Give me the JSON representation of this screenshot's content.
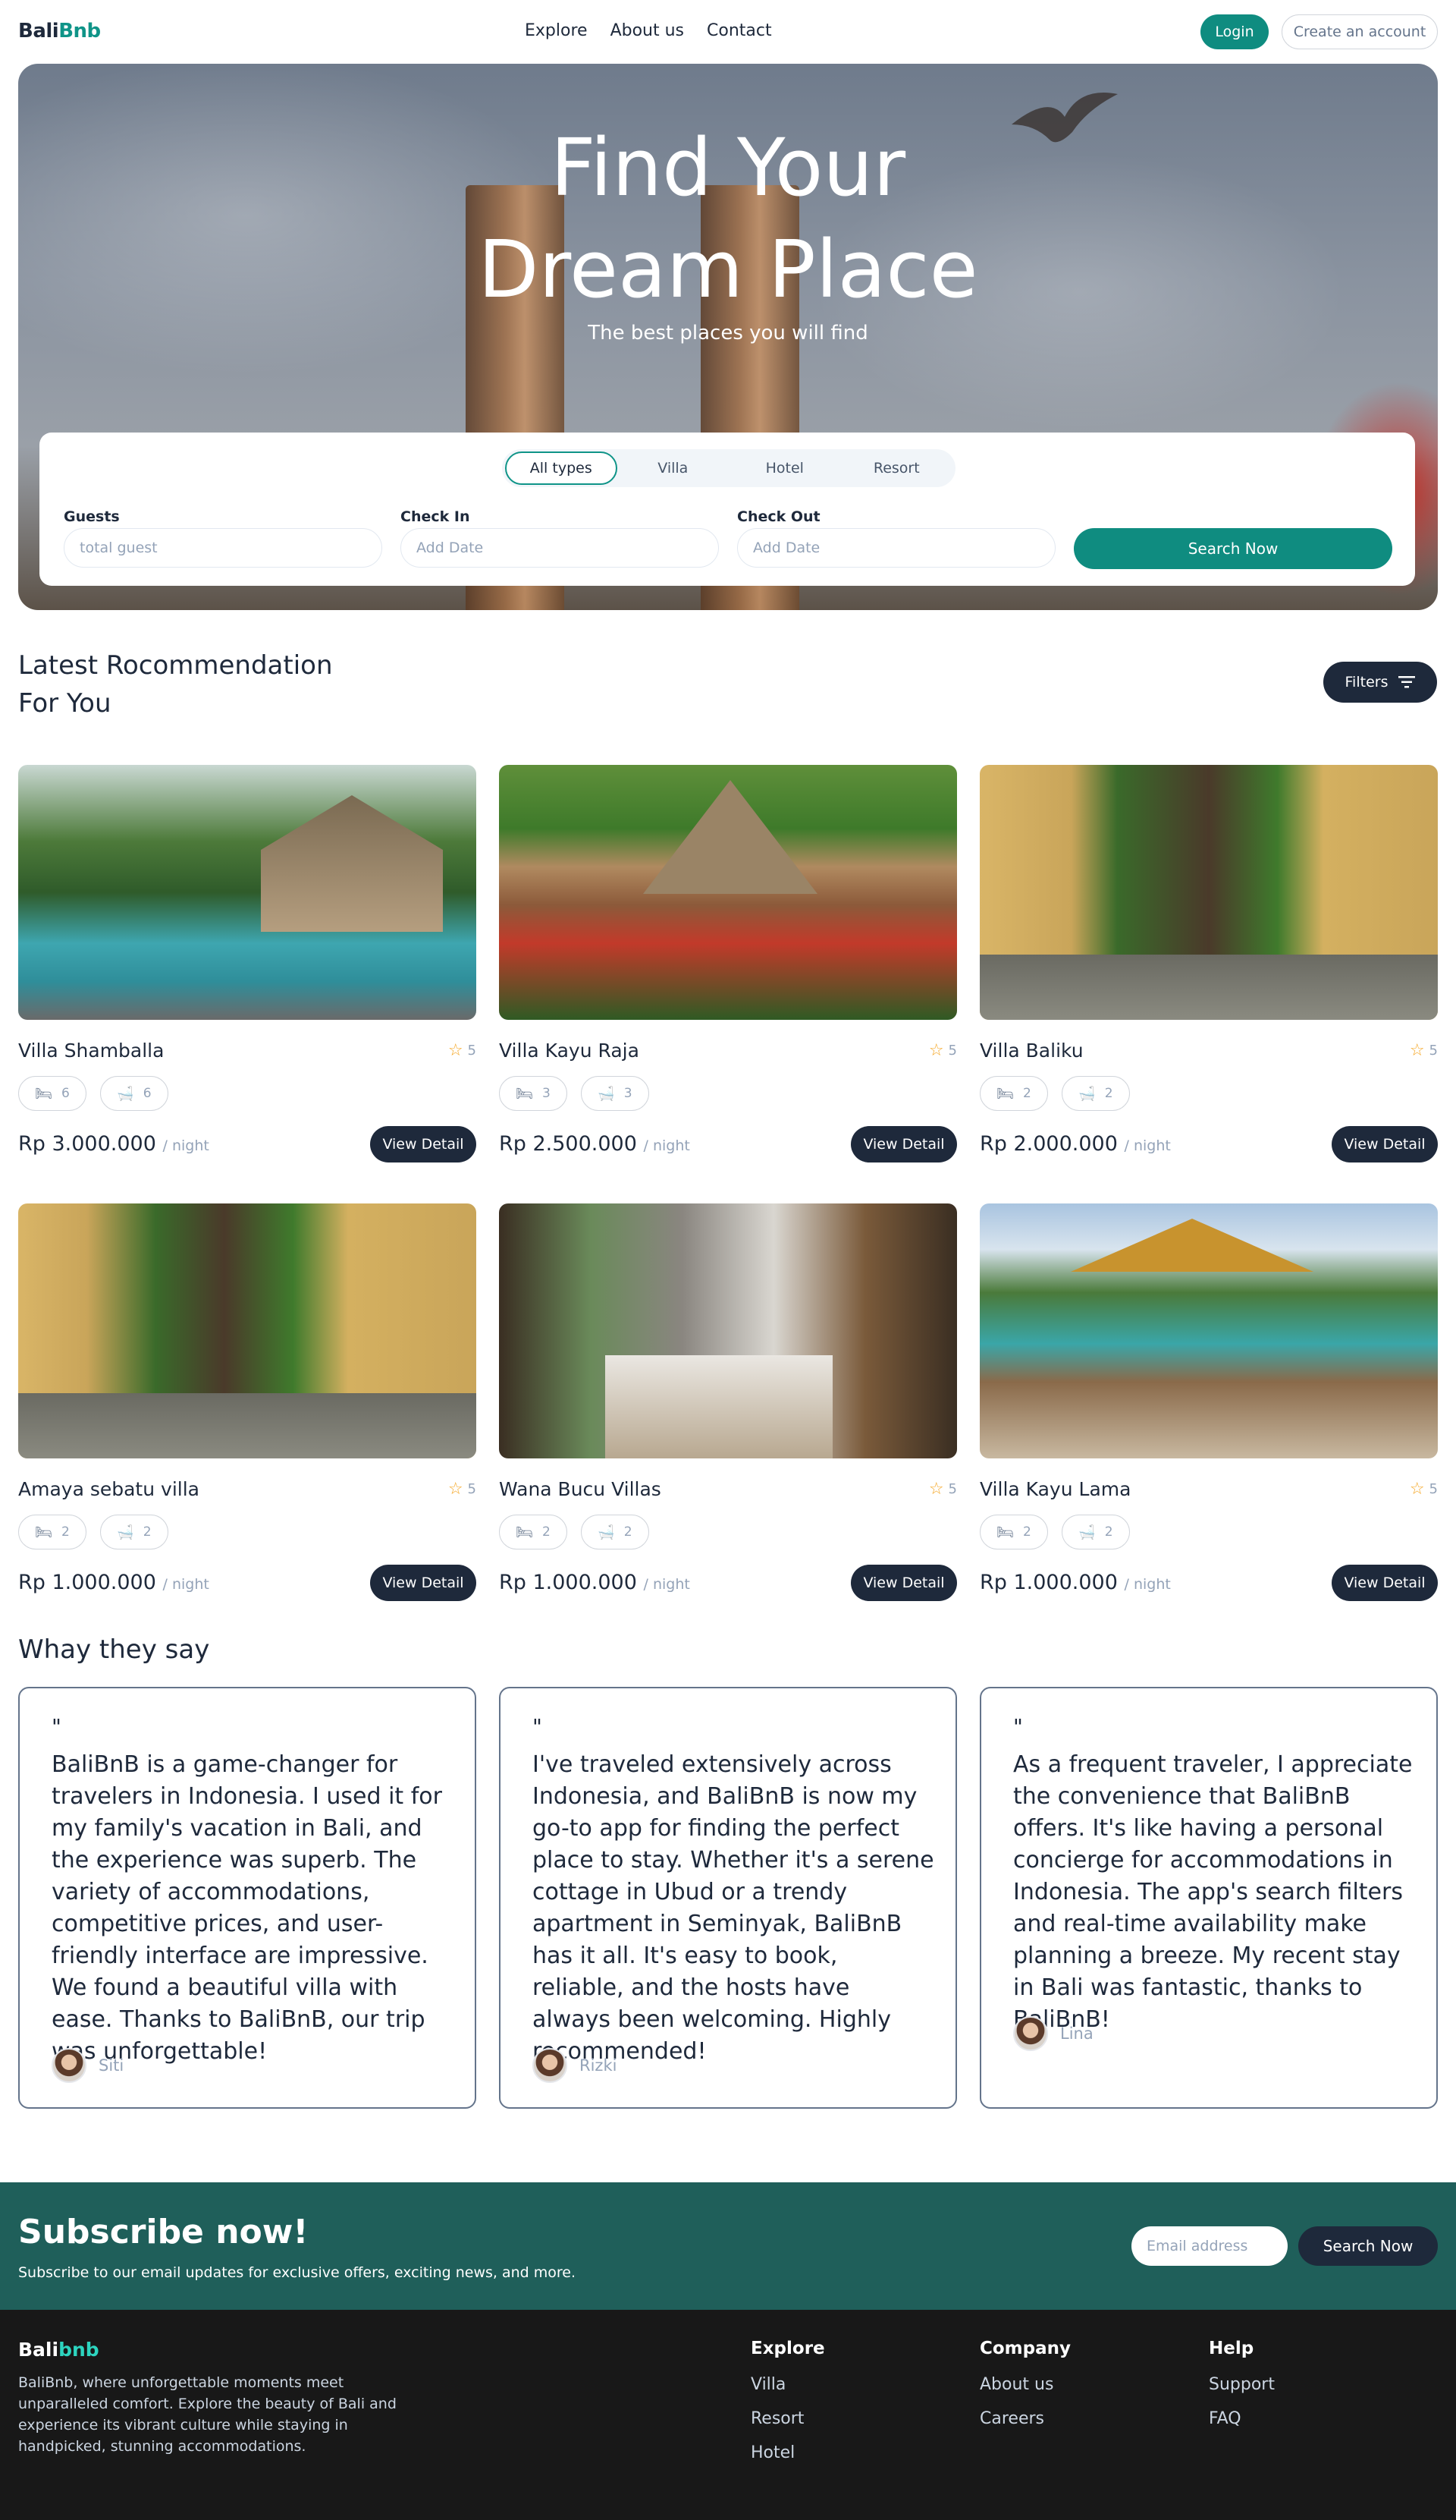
{
  "nav": {
    "logo_a": "Bali",
    "logo_b": "Bnb",
    "links": [
      "Explore",
      "About us",
      "Contact"
    ],
    "login": "Login",
    "create_account": "Create an account"
  },
  "hero": {
    "title_line1": "Find Your",
    "title_line2": "Dream Place",
    "subtitle": "The best places you will find"
  },
  "search": {
    "types": [
      "All types",
      "Villa",
      "Hotel",
      "Resort"
    ],
    "active_type": "All types",
    "guests_label": "Guests",
    "guests_placeholder": "total guest",
    "checkin_label": "Check In",
    "checkin_placeholder": "Add Date",
    "checkout_label": "Check Out",
    "checkout_placeholder": "Add Date",
    "button": "Search Now"
  },
  "recommendations": {
    "title_line1": "Latest Rocommendation",
    "title_line2": "For You",
    "filters": "Filters",
    "view_detail": "View Detail",
    "per_night": "/ night",
    "items": [
      {
        "name": "Villa Shamballa",
        "rating": "5",
        "beds": "6",
        "baths": "6",
        "price": "Rp 3.000.000"
      },
      {
        "name": "Villa Kayu Raja",
        "rating": "5",
        "beds": "3",
        "baths": "3",
        "price": "Rp 2.500.000"
      },
      {
        "name": "Villa Baliku",
        "rating": "5",
        "beds": "2",
        "baths": "2",
        "price": "Rp 2.000.000"
      },
      {
        "name": "Amaya sebatu villa",
        "rating": "5",
        "beds": "2",
        "baths": "2",
        "price": "Rp 1.000.000"
      },
      {
        "name": "Wana Bucu Villas",
        "rating": "5",
        "beds": "2",
        "baths": "2",
        "price": "Rp 1.000.000"
      },
      {
        "name": "Villa Kayu Lama",
        "rating": "5",
        "beds": "2",
        "baths": "2",
        "price": "Rp 1.000.000"
      }
    ]
  },
  "testimonials": {
    "title": "Whay they say",
    "quote_mark": "\"",
    "items": [
      {
        "text": "BaliBnB is a game-changer for travelers in Indonesia. I used it for my family's vacation in Bali, and the experience was superb. The variety of accommodations, competitive prices, and user-friendly interface are impressive. We found a beautiful villa with ease. Thanks to BaliBnB, our trip was unforgettable!",
        "name": "Siti"
      },
      {
        "text": "I've traveled extensively across Indonesia, and BaliBnB is now my go-to app for finding the perfect place to stay. Whether it's a serene cottage in Ubud or a trendy apartment in Seminyak, BaliBnB has it all. It's easy to book, reliable, and the hosts have always been welcoming. Highly recommended!",
        "name": "Rizki"
      },
      {
        "text": "As a frequent traveler, I appreciate the convenience that BaliBnB offers. It's like having a personal concierge for accommodations in Indonesia. The app's search filters and real-time availability make planning a breeze. My recent stay in Bali was fantastic, thanks to BaliBnB!",
        "name": "Lina"
      }
    ]
  },
  "subscribe": {
    "title": "Subscribe now!",
    "text": "Subscribe to our email updates for exclusive offers, exciting news, and more.",
    "placeholder": "Email address",
    "button": "Search Now"
  },
  "footer": {
    "logo_a": "Bali",
    "logo_b": "bnb",
    "description": "BaliBnb, where unforgettable moments meet unparalleled comfort. Explore the beauty of Bali and experience its vibrant culture while staying in handpicked, stunning accommodations.",
    "explore": {
      "title": "Explore",
      "items": [
        "Villa",
        "Resort",
        "Hotel"
      ]
    },
    "company": {
      "title": "Company",
      "items": [
        "About us",
        "Careers"
      ]
    },
    "help": {
      "title": "Help",
      "items": [
        "Support",
        "FAQ"
      ]
    }
  },
  "colors": {
    "accent": "#0f8c80",
    "dark": "#1e293b",
    "subscribe_bg": "#1f5f5a",
    "footer_bg": "#181818",
    "star": "#f5a623"
  }
}
